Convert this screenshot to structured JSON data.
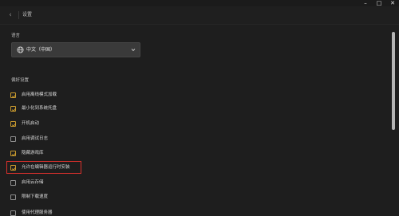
{
  "window": {
    "minimize": "–",
    "maximize": "□",
    "close": "✕"
  },
  "header": {
    "back": "‹",
    "title": "设置"
  },
  "language": {
    "label": "语言",
    "selected": "中文（中国）"
  },
  "preferences": {
    "label": "偏好设置",
    "items": [
      {
        "label": "启用离线模式加载",
        "checked": true
      },
      {
        "label": "最小化到系统托盘",
        "checked": true
      },
      {
        "label": "开机启动",
        "checked": true
      },
      {
        "label": "启用调试日志",
        "checked": false
      },
      {
        "label": "隐藏游戏库",
        "checked": true
      },
      {
        "label": "允许在编辑器运行时安装",
        "checked": true
      },
      {
        "label": "启用云存储",
        "checked": false
      },
      {
        "label": "限制下载速度",
        "checked": false
      },
      {
        "label": "使用代理服务器",
        "checked": false
      }
    ]
  },
  "colors": {
    "accent": "#c99a2e",
    "highlight": "#d9302c",
    "background": "#1e1e1e"
  },
  "icons": {
    "globe": "globe-icon",
    "chevron": "chevron-down-icon",
    "back": "back-arrow-icon"
  }
}
